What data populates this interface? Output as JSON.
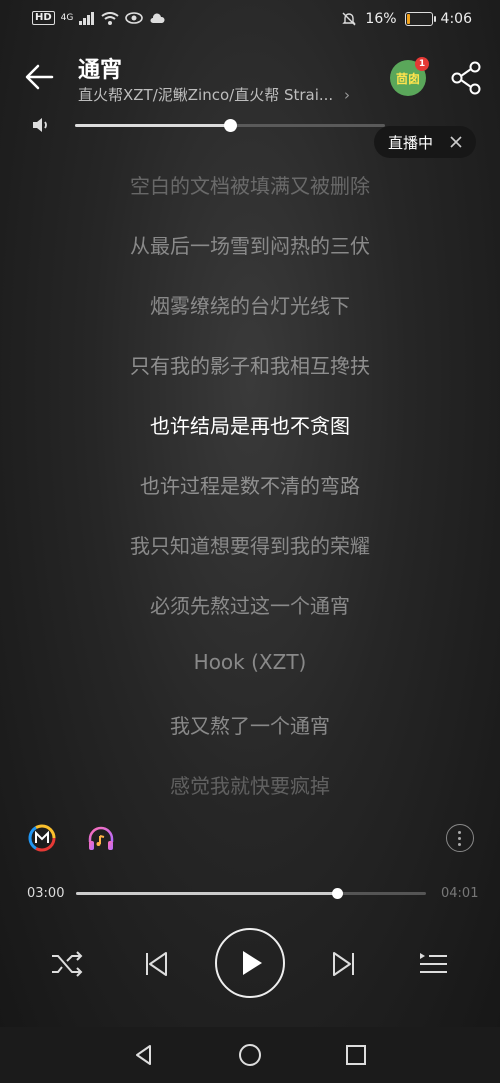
{
  "status_bar": {
    "left": {
      "hd": "HD",
      "network": "4G"
    },
    "battery": "16%",
    "time": "4:06"
  },
  "header": {
    "title": "通宵",
    "artist": "直火帮XZT/泥鳅Zinco/直火帮 Strai...",
    "badge_label": "茴囱",
    "badge_count": "1"
  },
  "volume": {
    "level": 0.5
  },
  "live": {
    "label": "直播中"
  },
  "lyrics": [
    "空白的文档被填满又被删除",
    "从最后一场雪到闷热的三伏",
    "烟雾缭绕的台灯光线下",
    "只有我的影子和我相互搀扶",
    "也许结局是再也不贪图",
    "也许过程是数不清的弯路",
    "我只知道想要得到我的荣耀",
    "必须先熬过这一个通宵",
    "Hook (XZT)",
    "我又熬了一个通宵",
    "感觉我就快要疯掉"
  ],
  "current_lyric_index": 4,
  "progress": {
    "current": "03:00",
    "total": "04:01",
    "fraction": 0.747
  },
  "icons": {
    "back": "back-arrow-icon",
    "share": "share-icon",
    "volume": "speaker-icon",
    "close": "close-icon",
    "member": "m-logo-icon",
    "headphones": "headphones-icon",
    "more": "more-vertical-icon",
    "shuffle": "shuffle-icon",
    "previous": "previous-icon",
    "play": "play-icon",
    "next": "next-icon",
    "playlist": "playlist-icon"
  }
}
